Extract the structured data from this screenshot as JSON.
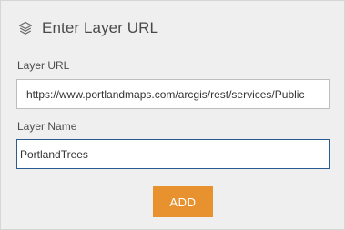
{
  "dialog": {
    "title": "Enter Layer URL",
    "header_icon": "layers-icon"
  },
  "layer_url": {
    "label": "Layer URL",
    "value": "https://www.portlandmaps.com/arcgis/rest/services/Public"
  },
  "layer_name": {
    "label": "Layer Name",
    "value": "PortlandTrees"
  },
  "actions": {
    "add_label": "ADD"
  },
  "colors": {
    "panel_background": "#efefef",
    "add_button": "#e8922f",
    "focus_border": "#2a5d8f"
  }
}
